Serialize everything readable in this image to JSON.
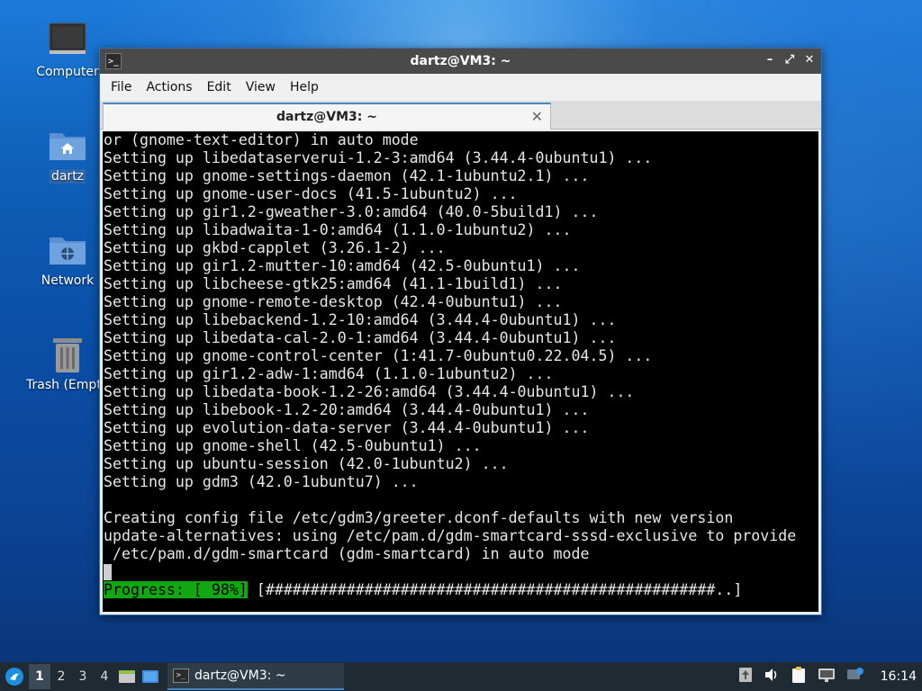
{
  "desktop": {
    "icons": [
      {
        "label": "Computer"
      },
      {
        "label": "dartz"
      },
      {
        "label": "Network"
      },
      {
        "label": "Trash (Empty)"
      }
    ]
  },
  "window": {
    "title": "dartz@VM3: ~",
    "menu": [
      "File",
      "Actions",
      "Edit",
      "View",
      "Help"
    ],
    "tab_title": "dartz@VM3: ~"
  },
  "terminal": {
    "lines": [
      "or (gnome-text-editor) in auto mode",
      "Setting up libedataserverui-1.2-3:amd64 (3.44.4-0ubuntu1) ...",
      "Setting up gnome-settings-daemon (42.1-1ubuntu2.1) ...",
      "Setting up gnome-user-docs (41.5-1ubuntu2) ...",
      "Setting up gir1.2-gweather-3.0:amd64 (40.0-5build1) ...",
      "Setting up libadwaita-1-0:amd64 (1.1.0-1ubuntu2) ...",
      "Setting up gkbd-capplet (3.26.1-2) ...",
      "Setting up gir1.2-mutter-10:amd64 (42.5-0ubuntu1) ...",
      "Setting up libcheese-gtk25:amd64 (41.1-1build1) ...",
      "Setting up gnome-remote-desktop (42.4-0ubuntu1) ...",
      "Setting up libebackend-1.2-10:amd64 (3.44.4-0ubuntu1) ...",
      "Setting up libedata-cal-2.0-1:amd64 (3.44.4-0ubuntu1) ...",
      "Setting up gnome-control-center (1:41.7-0ubuntu0.22.04.5) ...",
      "Setting up gir1.2-adw-1:amd64 (1.1.0-1ubuntu2) ...",
      "Setting up libedata-book-1.2-26:amd64 (3.44.4-0ubuntu1) ...",
      "Setting up libebook-1.2-20:amd64 (3.44.4-0ubuntu1) ...",
      "Setting up evolution-data-server (3.44.4-0ubuntu1) ...",
      "Setting up gnome-shell (42.5-0ubuntu1) ...",
      "Setting up ubuntu-session (42.0-1ubuntu2) ...",
      "Setting up gdm3 (42.0-1ubuntu7) ...",
      "",
      "Creating config file /etc/gdm3/greeter.dconf-defaults with new version",
      "update-alternatives: using /etc/pam.d/gdm-smartcard-sssd-exclusive to provide",
      " /etc/pam.d/gdm-smartcard (gdm-smartcard) in auto mode"
    ],
    "progress_label": "Progress: [ 98%]",
    "progress_bar": " [##################################################..]",
    "progress_percent": 98
  },
  "taskbar": {
    "workspaces": [
      "1",
      "2",
      "3",
      "4"
    ],
    "active_workspace": "1",
    "task_title": "dartz@VM3: ~",
    "clock": "16:14"
  },
  "colors": {
    "progress_green": "#12a812",
    "terminal_bg": "#000000",
    "titlebar": "#4a4a4a",
    "taskbar": "#1f2a33"
  }
}
